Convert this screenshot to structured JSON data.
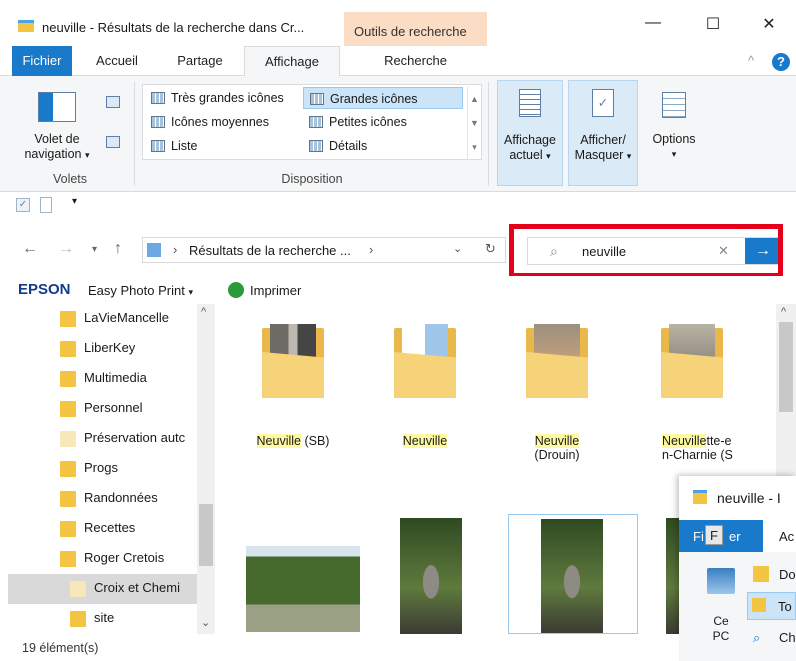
{
  "window": {
    "title": "neuville - Résultats de la recherche dans Cr...",
    "context_tab": "Outils de recherche",
    "minimize": "—",
    "maximize": "☐",
    "close": "✕"
  },
  "tabs": {
    "file": "Fichier",
    "home": "Accueil",
    "share": "Partage",
    "view": "Affichage",
    "search": "Recherche",
    "collapse": "^",
    "help": "?"
  },
  "ribbon": {
    "panes": {
      "nav_pane_line1": "Volet de",
      "nav_pane_line2": "navigation",
      "label": "Volets"
    },
    "layout": {
      "items": [
        "Très grandes icônes",
        "Grandes icônes",
        "Icônes moyennes",
        "Petites icônes",
        "Liste",
        "Détails"
      ],
      "label": "Disposition"
    },
    "current_view_line1": "Affichage",
    "current_view_line2": "actuel",
    "show_hide_line1": "Afficher/",
    "show_hide_line2": "Masquer",
    "options": "Options"
  },
  "address": {
    "path": "Résultats de la recherche ...",
    "search_value": "neuville",
    "clear": "✕",
    "go": "→"
  },
  "epson": {
    "brand": "EPSON",
    "app": "Easy Photo Print",
    "print": "Imprimer"
  },
  "nav_tree": [
    "LaVieMancelle",
    "LiberKey",
    "Multimedia",
    "Personnel",
    "Préservation autc",
    "Progs",
    "Randonnées",
    "Recettes",
    "Roger Cretois",
    "Croix et Chemi",
    "site"
  ],
  "files": [
    {
      "hl": "Neuville",
      "rest": " (SB)"
    },
    {
      "hl": "Neuville",
      "rest": ""
    },
    {
      "hl": "Neuville",
      "rest": "(Drouin)"
    },
    {
      "hl": "Neuville",
      "rest": "tte-en-Charnie (S"
    }
  ],
  "overlay": {
    "title": "neuville - I",
    "tab_file": "Fi",
    "key_hint": "F",
    "tab_rest": "er",
    "tab_next": "Ac",
    "pc_label_line1": "Ce",
    "pc_label_line2": "PC",
    "item1": "Do",
    "item2": "To",
    "item3": "Ch"
  },
  "status": {
    "count": "19 élément(s)"
  },
  "colors": {
    "accent": "#1979ca",
    "context_tab": "#fbdcc4",
    "highlight_box": "#e4001b",
    "search_match": "#fffaa0"
  }
}
